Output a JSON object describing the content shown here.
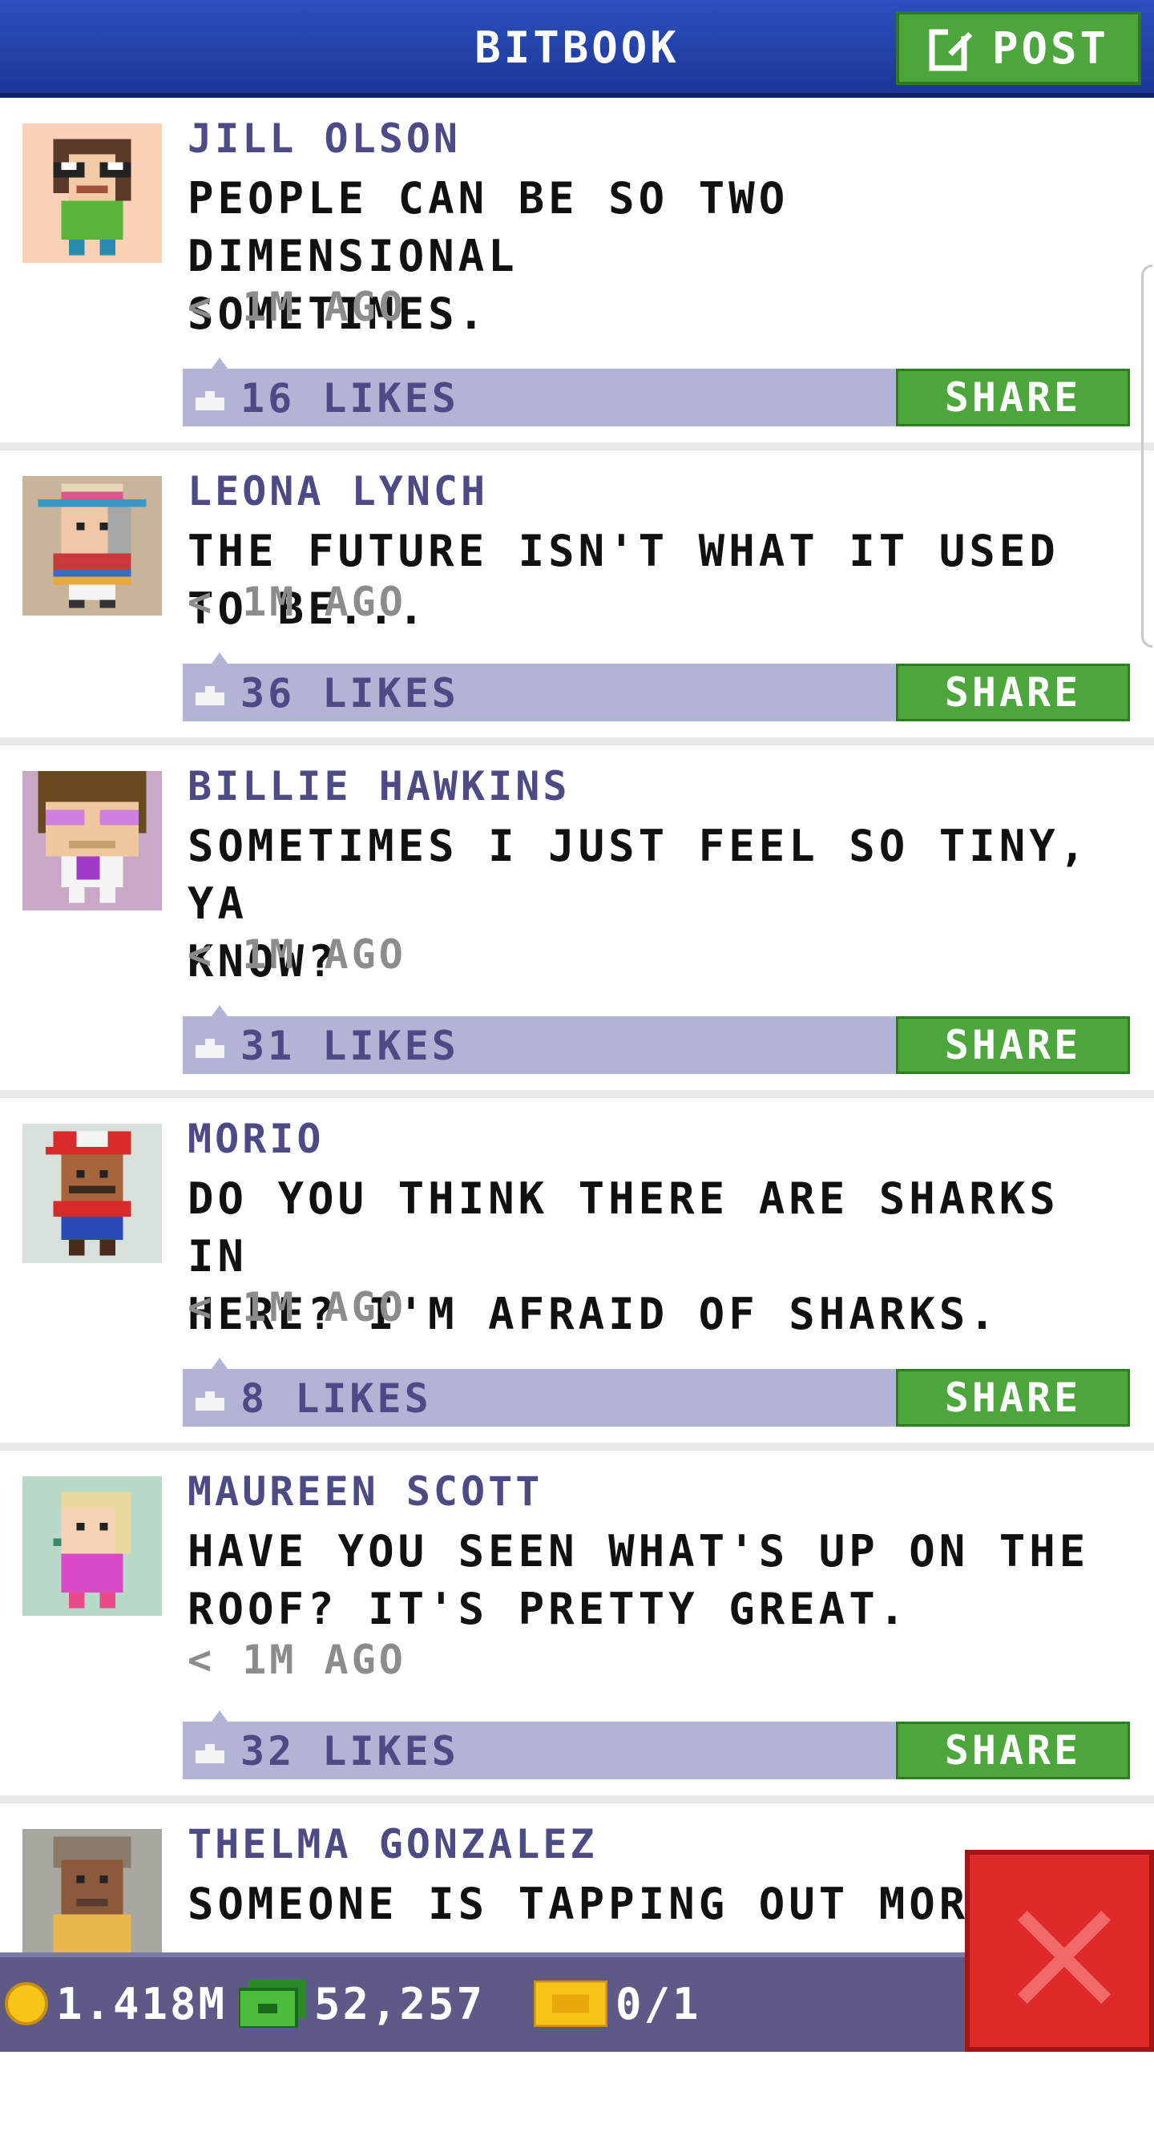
{
  "header": {
    "title": "BITBOOK",
    "post_label": "POST"
  },
  "posts": [
    {
      "name": "JILL OLSON",
      "message": "PEOPLE CAN BE SO TWO DIMENSIONAL\nSOMETIMES.",
      "time": "< 1M AGO",
      "likes": "16 LIKES",
      "share": "SHARE",
      "avatar_bg": "#fdd0b8"
    },
    {
      "name": "LEONA LYNCH",
      "message": "THE FUTURE ISN'T WHAT IT USED TO BE...",
      "time": "< 1M AGO",
      "likes": "36 LIKES",
      "share": "SHARE",
      "avatar_bg": "#c8b49a"
    },
    {
      "name": "BILLIE HAWKINS",
      "message": "SOMETIMES I JUST FEEL SO TINY, YA\nKNOW?",
      "time": "< 1M AGO",
      "likes": "31 LIKES",
      "share": "SHARE",
      "avatar_bg": "#c8a8c4"
    },
    {
      "name": "MORIO",
      "message": "DO YOU THINK THERE ARE SHARKS IN\nHERE? I'M AFRAID OF SHARKS.",
      "time": "< 1M AGO",
      "likes": "8 LIKES",
      "share": "SHARE",
      "avatar_bg": "#d8e0dc"
    },
    {
      "name": "MAUREEN SCOTT",
      "message": "HAVE YOU SEEN WHAT'S UP ON THE\nROOF? IT'S PRETTY GREAT.",
      "time": "< 1M AGO",
      "likes": "32 LIKES",
      "share": "SHARE",
      "avatar_bg": "#b8d8c8"
    },
    {
      "name": "THELMA GONZALEZ",
      "message": "SOMEONE IS TAPPING OUT MORS",
      "time": "",
      "likes": "",
      "share": "",
      "avatar_bg": "#a8a8a0"
    }
  ],
  "bottom_bar": {
    "coins": "1.418M",
    "bux": "52,257",
    "tickets": "0/1"
  },
  "colors": {
    "header": "#2d4fbf",
    "accent_green": "#4ca63c",
    "likes_bar": "#b3b3d6",
    "name_purple": "#4d4a86",
    "close_red": "#e02a2a"
  },
  "icons": {
    "post": "edit-icon",
    "like": "thumbs-up-icon",
    "coin": "coin-icon",
    "bux": "bitbux-icon",
    "ticket": "ticket-icon",
    "close": "close-icon"
  }
}
